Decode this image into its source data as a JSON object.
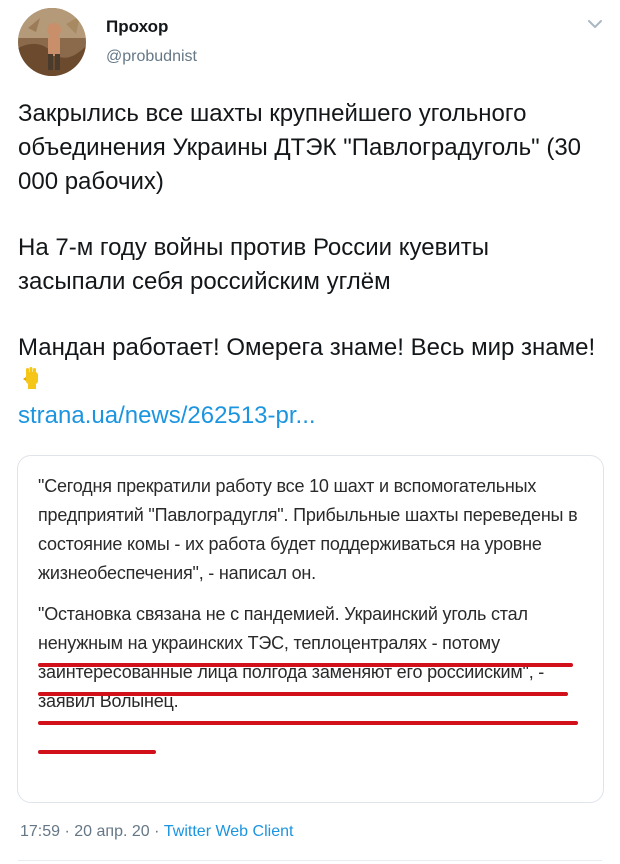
{
  "user": {
    "name": "Прохор",
    "handle": "@probudnist"
  },
  "tweet": {
    "paragraphs": [
      "Закрылись все шахты крупнейшего угольного объединения Украины ДТЭК \"Павлоградуголь\" (30 000 рабочих)",
      "На 7-м году войны против России куевиты засыпали себя российским углём",
      "Мандан работает! Омерега знаме! Весь мир знаме!"
    ],
    "link_text": "strana.ua/news/262513-pr..."
  },
  "quote": {
    "paragraph1": "\"Сегодня прекратили работу все 10 шахт и вспомогательных предприятий \"Павлоградугля\". Прибыльные шахты переведены в состояние комы - их работа будет поддерживаться на уровне жизнеобеспечения\", - написал он.",
    "paragraph2": "\"Остановка связана не с пандемией. Украинский уголь стал ненужным на украинских ТЭС, теплоцентралях - потому заинтересованные лица полгода заменяют его российским\", - заявил Волынец."
  },
  "meta": {
    "time": "17:59",
    "sep1": "·",
    "date": "20 апр. 20",
    "sep2": "·",
    "source": "Twitter Web Client"
  },
  "colors": {
    "accent": "#1b95e0",
    "underline": "#d1101a",
    "fist_emoji": "#f5c518"
  },
  "icons": {
    "chevron": "chevron-down-icon",
    "emoji": "raised-fist-emoji"
  }
}
